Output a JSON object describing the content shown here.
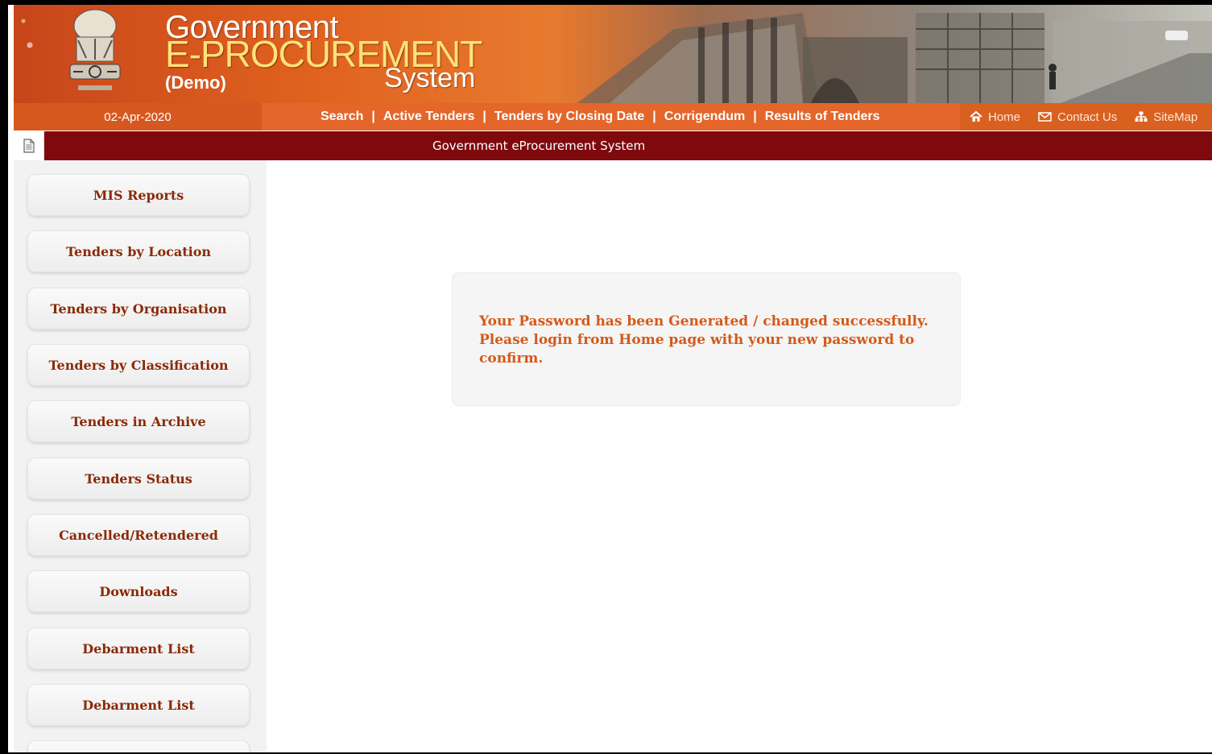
{
  "header": {
    "brand_line1": "Government",
    "brand_line2": "E-PROCUREMENT",
    "brand_line3": "System",
    "brand_demo": "(Demo)"
  },
  "navbar": {
    "date": "02-Apr-2020",
    "links": [
      "Search",
      "Active Tenders",
      "Tenders by Closing Date",
      "Corrigendum",
      "Results of Tenders"
    ],
    "separator": "|",
    "right_links": [
      {
        "label": "Home",
        "icon": "home-icon"
      },
      {
        "label": "Contact Us",
        "icon": "mail-icon"
      },
      {
        "label": "SiteMap",
        "icon": "sitemap-icon"
      }
    ]
  },
  "strip": {
    "title": "Government eProcurement System",
    "icon": "document-icon"
  },
  "sidebar": {
    "items": [
      {
        "label": "MIS Reports"
      },
      {
        "label": "Tenders by Location"
      },
      {
        "label": "Tenders by Organisation"
      },
      {
        "label": "Tenders by Classification"
      },
      {
        "label": "Tenders in Archive"
      },
      {
        "label": "Tenders Status"
      },
      {
        "label": "Cancelled/Retendered"
      },
      {
        "label": "Downloads"
      },
      {
        "label": "Debarment List"
      },
      {
        "label": "Debarment List"
      }
    ]
  },
  "message": {
    "text": "Your Password has been Generated / changed successfully. Please login from Home page with your new password to confirm."
  },
  "colors": {
    "nav_orange": "#e4662a",
    "strip_maroon": "#7f0a0e",
    "sidebar_text": "#8a2a06",
    "message_text": "#d45a1a"
  }
}
